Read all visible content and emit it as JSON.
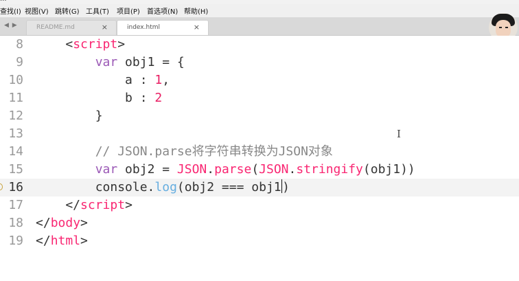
{
  "window": {
    "title": "..."
  },
  "menu": {
    "items": [
      {
        "label": "查找(I)"
      },
      {
        "label": "视图(V)"
      },
      {
        "label": "跳转(G)"
      },
      {
        "label": "工具(T)"
      },
      {
        "label": "项目(P)"
      },
      {
        "label": "首选项(N)"
      },
      {
        "label": "帮助(H)"
      }
    ]
  },
  "tabs": [
    {
      "label": "README.md",
      "active": false,
      "close": "×"
    },
    {
      "label": "index.html",
      "active": true,
      "close": "×"
    }
  ],
  "nav": {
    "arrows": "◀ ▶"
  },
  "editor": {
    "current_line": "16",
    "lines": [
      {
        "num": "8",
        "tokens": [
          {
            "t": "    "
          },
          {
            "t": "<",
            "c": "plain"
          },
          {
            "t": "script",
            "c": "tag"
          },
          {
            "t": ">",
            "c": "plain"
          }
        ]
      },
      {
        "num": "9",
        "tokens": [
          {
            "t": "        "
          },
          {
            "t": "var",
            "c": "kw"
          },
          {
            "t": " obj1 = {",
            "c": "plain"
          }
        ]
      },
      {
        "num": "10",
        "tokens": [
          {
            "t": "            a : ",
            "c": "plain"
          },
          {
            "t": "1",
            "c": "num"
          },
          {
            "t": ",",
            "c": "plain"
          }
        ]
      },
      {
        "num": "11",
        "tokens": [
          {
            "t": "            b : ",
            "c": "plain"
          },
          {
            "t": "2",
            "c": "num"
          }
        ]
      },
      {
        "num": "12",
        "tokens": [
          {
            "t": "        }",
            "c": "plain"
          }
        ]
      },
      {
        "num": "13",
        "tokens": []
      },
      {
        "num": "14",
        "tokens": [
          {
            "t": "        "
          },
          {
            "t": "// JSON.parse将字符串转换为JSON对象",
            "c": "cmt"
          }
        ]
      },
      {
        "num": "15",
        "tokens": [
          {
            "t": "        "
          },
          {
            "t": "var",
            "c": "kw"
          },
          {
            "t": " obj2 = ",
            "c": "plain"
          },
          {
            "t": "JSON",
            "c": "fn"
          },
          {
            "t": ".",
            "c": "plain"
          },
          {
            "t": "parse",
            "c": "fn"
          },
          {
            "t": "(",
            "c": "plain"
          },
          {
            "t": "JSON",
            "c": "fn"
          },
          {
            "t": ".",
            "c": "plain"
          },
          {
            "t": "stringify",
            "c": "fn"
          },
          {
            "t": "(obj1))",
            "c": "plain"
          }
        ]
      },
      {
        "num": "16",
        "tokens": [
          {
            "t": "        console.",
            "c": "plain"
          },
          {
            "t": "log",
            "c": "log"
          },
          {
            "t": "(obj2 === obj1",
            "c": "plain"
          },
          {
            "cursor": true
          },
          {
            "t": ")",
            "c": "plain"
          }
        ]
      },
      {
        "num": "17",
        "tokens": [
          {
            "t": "    </",
            "c": "plain"
          },
          {
            "t": "script",
            "c": "tag"
          },
          {
            "t": ">",
            "c": "plain"
          }
        ]
      },
      {
        "num": "18",
        "tokens": [
          {
            "t": "</",
            "c": "plain"
          },
          {
            "t": "body",
            "c": "tag"
          },
          {
            "t": ">",
            "c": "plain"
          }
        ]
      },
      {
        "num": "19",
        "tokens": [
          {
            "t": "</",
            "c": "plain"
          },
          {
            "t": "html",
            "c": "tag"
          },
          {
            "t": ">",
            "c": "plain"
          }
        ]
      }
    ]
  },
  "ibeam_glyph": "I",
  "colors": {
    "tag": "#f92672",
    "keyword": "#9b59b6",
    "number": "#e91e63",
    "comment": "#888888",
    "method": "#66aee0"
  }
}
